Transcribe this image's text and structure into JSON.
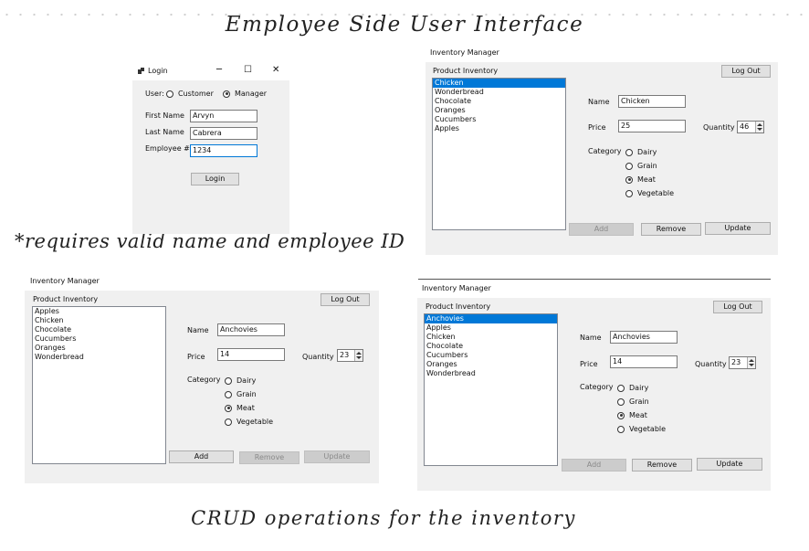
{
  "headings": {
    "title": "Employee Side User Interface",
    "note": "*requires valid name and employee ID",
    "caption": "CRUD operations for the inventory"
  },
  "login": {
    "title": "Login",
    "controls": {
      "minimize": "─",
      "maximize": "☐",
      "close": "✕"
    },
    "user_label": "User:",
    "customer_label": "Customer",
    "manager_label": "Manager",
    "selected_role": "manager",
    "first_name_label": "First Name",
    "first_name_value": "Arvyn",
    "last_name_label": "Last Name",
    "last_name_value": "Cabrera",
    "employee_label": "Employee #",
    "employee_value": "1234",
    "login_button": "Login"
  },
  "windows": [
    {
      "title": "Inventory Manager",
      "product_label": "Product Inventory",
      "logout": "Log Out",
      "items": [
        "Chicken",
        "Wonderbread",
        "Chocolate",
        "Oranges",
        "Cucumbers",
        "Apples"
      ],
      "selected_index": 0,
      "name_label": "Name",
      "name_value": "Chicken",
      "price_label": "Price",
      "price_value": "25",
      "quantity_label": "Quantity",
      "quantity_value": "46",
      "category_label": "Category",
      "categories": [
        "Dairy",
        "Grain",
        "Meat",
        "Vegetable"
      ],
      "selected_category": "Meat",
      "add": "Add",
      "remove": "Remove",
      "update": "Update",
      "add_enabled": false,
      "remove_enabled": true,
      "update_enabled": true
    },
    {
      "title": "Inventory Manager",
      "product_label": "Product Inventory",
      "logout": "Log Out",
      "items": [
        "Apples",
        "Chicken",
        "Chocolate",
        "Cucumbers",
        "Oranges",
        "Wonderbread"
      ],
      "selected_index": -1,
      "name_label": "Name",
      "name_value": "Anchovies",
      "price_label": "Price",
      "price_value": "14",
      "quantity_label": "Quantity",
      "quantity_value": "23",
      "category_label": "Category",
      "categories": [
        "Dairy",
        "Grain",
        "Meat",
        "Vegetable"
      ],
      "selected_category": "Meat",
      "add": "Add",
      "remove": "Remove",
      "update": "Update",
      "add_enabled": true,
      "remove_enabled": false,
      "update_enabled": false
    },
    {
      "title": "Inventory Manager",
      "product_label": "Product Inventory",
      "logout": "Log Out",
      "items": [
        "Anchovies",
        "Apples",
        "Chicken",
        "Chocolate",
        "Cucumbers",
        "Oranges",
        "Wonderbread"
      ],
      "selected_index": 0,
      "name_label": "Name",
      "name_value": "Anchovies",
      "price_label": "Price",
      "price_value": "14",
      "quantity_label": "Quantity",
      "quantity_value": "23",
      "category_label": "Category",
      "categories": [
        "Dairy",
        "Grain",
        "Meat",
        "Vegetable"
      ],
      "selected_category": "Meat",
      "add": "Add",
      "remove": "Remove",
      "update": "Update",
      "add_enabled": false,
      "remove_enabled": true,
      "update_enabled": true
    }
  ]
}
